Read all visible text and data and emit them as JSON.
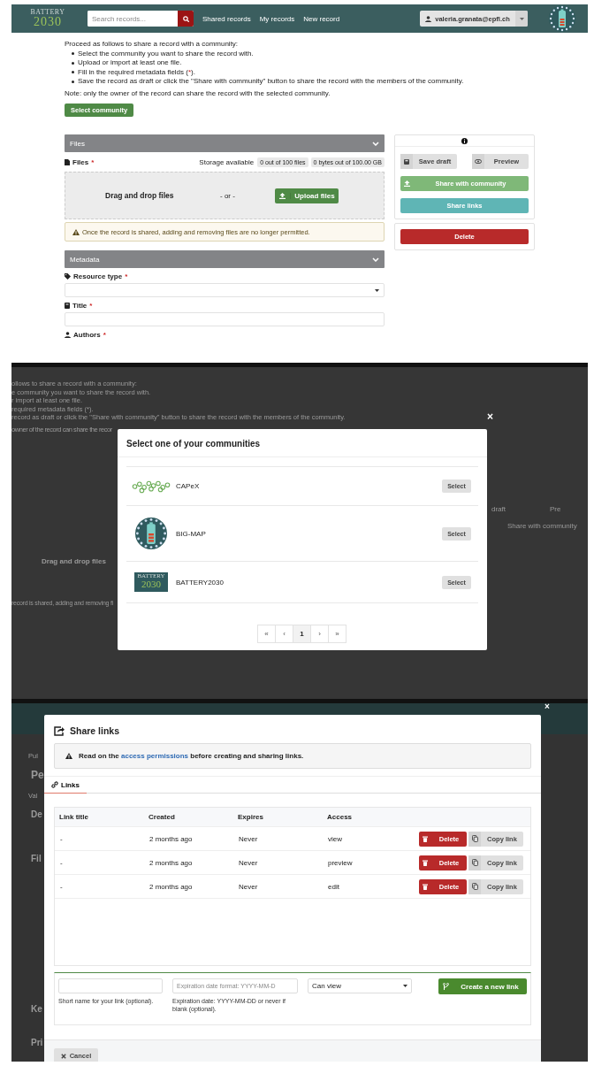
{
  "record_page": {
    "header": {
      "logo_lines": [
        "BATTERY",
        "2030"
      ],
      "search_placeholder": "Search records...",
      "nav": [
        "Shared records",
        "My records",
        "New record"
      ],
      "user": "valeria.granata@epfl.ch"
    },
    "instructions": {
      "intro": "Proceed as follows to share a record with a community:",
      "steps": [
        {
          "text": "Select the community you want to share the record with."
        },
        {
          "text": "Upload or import at least one file."
        },
        {
          "text": "Fill in the required metadata fields (",
          "required_mark": "*",
          "text_after": ")."
        },
        {
          "text": "Save the record as draft or click the \"Share with community\" button to share the record with the members of the community."
        }
      ],
      "note": "Note: only the owner of the record can share the record with the selected community."
    },
    "select_button": "Select community",
    "files": {
      "section_title": "Files",
      "label": "Files",
      "required_mark": "*",
      "storage_label": "Storage available",
      "badges": [
        "0 out of 100 files",
        "0 bytes out of 100.00 GB"
      ],
      "drop_text": "Drag and drop files",
      "or_text": "- or -",
      "upload_button": "Upload files",
      "warning": "Once the record is shared, adding and removing files are no longer permitted."
    },
    "metadata": {
      "section_title": "Metadata",
      "fields": [
        {
          "label": "Resource type",
          "required_mark": "*",
          "kind": "select"
        },
        {
          "label": "Title",
          "required_mark": "*",
          "kind": "text"
        },
        {
          "label": "Authors",
          "required_mark": "*",
          "kind": "none"
        }
      ]
    },
    "sidebar": {
      "buttons": [
        {
          "label": "Save draft",
          "kind": "half"
        },
        {
          "label": "Preview",
          "kind": "half"
        },
        {
          "label": "Share with community",
          "kind": "share"
        },
        {
          "label": "Share links",
          "kind": "links"
        }
      ],
      "delete_button": "Delete"
    }
  },
  "community_dialog": {
    "background_lines": [
      "ollows to share a record with a community:",
      "e community you want to share the record with.",
      "r import at least one file.",
      "required metadata fields (*).",
      "record as draft or click the \"Share with community\" button to share the record with the members of the community.",
      "owner of the record can share the recor"
    ],
    "background_left": [
      "Drag and drop files",
      "record is shared, adding and removing fi"
    ],
    "background_right": [
      "draft",
      "Pre",
      "Share with community"
    ],
    "close": "×",
    "title": "Select one of your communities",
    "communities": [
      {
        "name": "CAPeX",
        "kind": "rings",
        "button": "Select"
      },
      {
        "name": "BIG-MAP",
        "kind": "badge",
        "button": "Select"
      },
      {
        "name": "BATTERY2030",
        "kind": "wordmark",
        "logo_lines": [
          "BATTERY",
          "2030"
        ],
        "button": "Select"
      }
    ],
    "pagination": [
      {
        "label": "«",
        "selected": false
      },
      {
        "label": "‹",
        "selected": false
      },
      {
        "label": "1",
        "selected": true
      },
      {
        "label": "›",
        "selected": false
      },
      {
        "label": "»",
        "selected": false
      }
    ]
  },
  "links_dialog": {
    "background_fragments": [
      "Pul",
      "Pe",
      "Val",
      "De",
      "Fil",
      "Ke",
      "Pri"
    ],
    "close": "×",
    "title": "Share links",
    "notice": {
      "before": "Read on the",
      "link": "access permissions",
      "after": "before creating and sharing links."
    },
    "tabs": [
      {
        "label": "Links",
        "selected": true
      }
    ],
    "columns": [
      "Link title",
      "Created",
      "Expires",
      "Access"
    ],
    "rows": [
      {
        "title": "-",
        "created": "2 months ago",
        "expires": "Never",
        "access": "view",
        "delete": "Delete",
        "copy": "Copy link"
      },
      {
        "title": "-",
        "created": "2 months ago",
        "expires": "Never",
        "access": "preview",
        "delete": "Delete",
        "copy": "Copy link"
      },
      {
        "title": "-",
        "created": "2 months ago",
        "expires": "Never",
        "access": "edit",
        "delete": "Delete",
        "copy": "Copy link"
      }
    ],
    "form": {
      "name_help": "Short name for your link (optional).",
      "expiry_placeholder": "Expiration date format: YYYY-MM-D",
      "expiry_help": "Expiration date: YYYY-MM-DD or never if blank (optional).",
      "access_value": "Can view",
      "create_button": "Create a new link"
    },
    "cancel_button": "Cancel"
  }
}
